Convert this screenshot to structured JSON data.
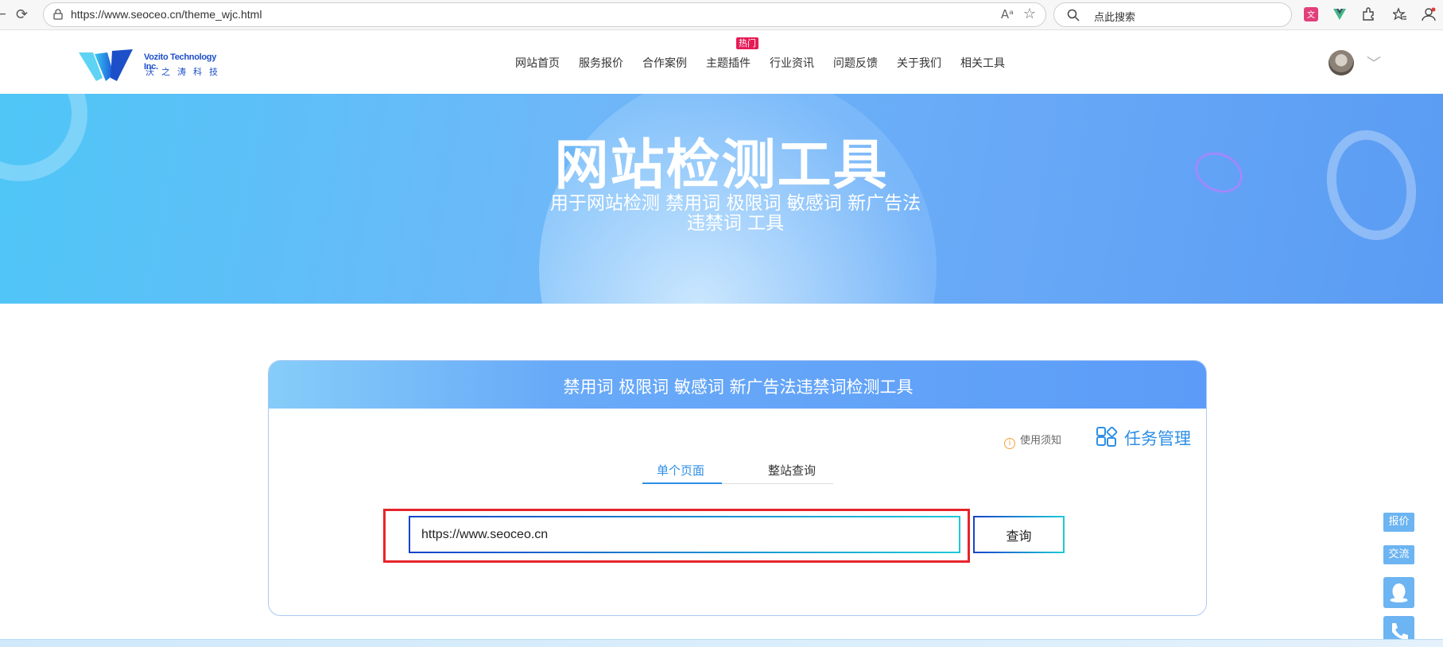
{
  "browser": {
    "url": "https://www.seoceo.cn/theme_wjc.html",
    "search_placeholder": "点此搜索"
  },
  "site": {
    "brand_en": "Vozito Technology Inc.",
    "brand_cn": "沃之涛科技",
    "nav": [
      {
        "label": "网站首页"
      },
      {
        "label": "服务报价"
      },
      {
        "label": "合作案例"
      },
      {
        "label": "主题插件"
      },
      {
        "label": "行业资讯"
      },
      {
        "label": "问题反馈"
      },
      {
        "label": "关于我们"
      },
      {
        "label": "相关工具"
      }
    ],
    "hot_badge": "热门"
  },
  "hero": {
    "title": "网站检测工具",
    "subtitle": "用于网站检测 禁用词 极限词 敏感词 新广告法违禁词 工具"
  },
  "tool": {
    "card_title": "禁用词 极限词 敏感词 新广告法违禁词检测工具",
    "notice_label": "使用须知",
    "task_label": "任务管理",
    "tabs": [
      {
        "label": "单个页面",
        "active": true
      },
      {
        "label": "整站查询",
        "active": false
      }
    ],
    "input_value": "https://www.seoceo.cn",
    "query_label": "查询"
  },
  "side": {
    "quote_label": "报价",
    "chat_label": "交流"
  },
  "colors": {
    "accent": "#2e8fe6",
    "highlight": "#e6252c",
    "hot": "#e51b55"
  }
}
